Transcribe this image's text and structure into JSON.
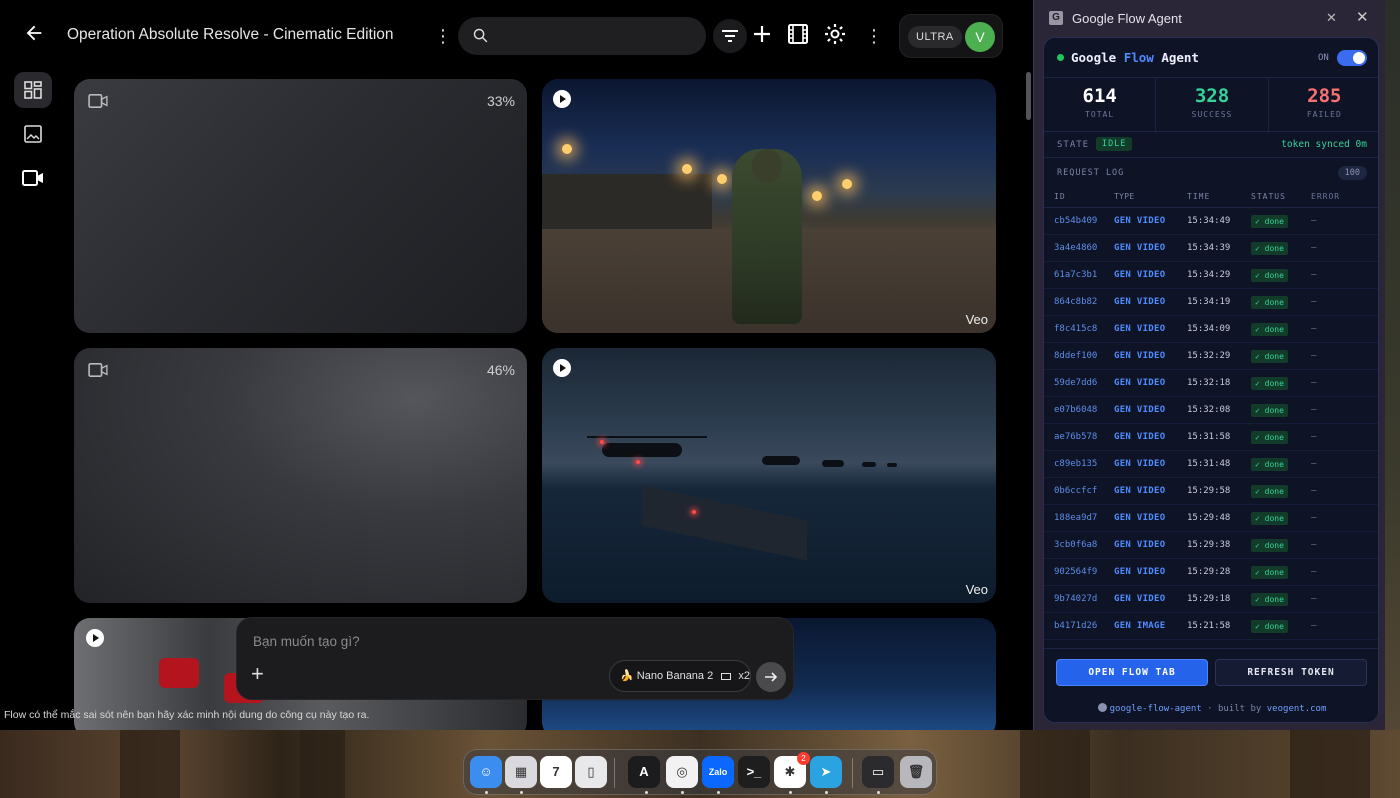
{
  "flow": {
    "project_title": "Operation Absolute Resolve - Cinematic Edition",
    "search_placeholder": "",
    "plan_badge": "ULTRA",
    "avatar_letter": "V",
    "tiles": [
      {
        "kind": "pending",
        "progress": "33%"
      },
      {
        "kind": "video",
        "label": "Veo"
      },
      {
        "kind": "pending",
        "progress": "46%"
      },
      {
        "kind": "video",
        "label": "Veo"
      }
    ],
    "prompt_placeholder": "Bạn muốn tạo gì?",
    "model_chip": {
      "name": "Nano Banana 2",
      "count": "x2",
      "emoji": "🍌"
    },
    "disclaimer": "Flow có thể mắc sai sót nên bạn hãy xác minh nội dung do công cụ này tạo ra."
  },
  "agent": {
    "window_title": "Google Flow Agent",
    "title_prefix": "Google ",
    "title_accent": "Flow",
    "title_suffix": " Agent",
    "toggle_label": "ON",
    "stats": [
      {
        "value": "614",
        "label": "TOTAL",
        "color": "#ffffff"
      },
      {
        "value": "328",
        "label": "SUCCESS",
        "color": "#34d399"
      },
      {
        "value": "285",
        "label": "FAILED",
        "color": "#f87171"
      }
    ],
    "state_label": "STATE",
    "state_value": "IDLE",
    "token_status": "token synced 0m",
    "log_label": "REQUEST LOG",
    "log_count": "100",
    "columns": [
      "ID",
      "TYPE",
      "TIME",
      "STATUS",
      "ERROR"
    ],
    "rows": [
      {
        "id": "cb54b409",
        "type": "GEN VIDEO",
        "time": "15:34:49",
        "status": "✓ done",
        "error": "—"
      },
      {
        "id": "3a4e4860",
        "type": "GEN VIDEO",
        "time": "15:34:39",
        "status": "✓ done",
        "error": "—"
      },
      {
        "id": "61a7c3b1",
        "type": "GEN VIDEO",
        "time": "15:34:29",
        "status": "✓ done",
        "error": "—"
      },
      {
        "id": "864c8b82",
        "type": "GEN VIDEO",
        "time": "15:34:19",
        "status": "✓ done",
        "error": "—"
      },
      {
        "id": "f8c415c8",
        "type": "GEN VIDEO",
        "time": "15:34:09",
        "status": "✓ done",
        "error": "—"
      },
      {
        "id": "8ddef100",
        "type": "GEN VIDEO",
        "time": "15:32:29",
        "status": "✓ done",
        "error": "—"
      },
      {
        "id": "59de7dd6",
        "type": "GEN VIDEO",
        "time": "15:32:18",
        "status": "✓ done",
        "error": "—"
      },
      {
        "id": "e07b6048",
        "type": "GEN VIDEO",
        "time": "15:32:08",
        "status": "✓ done",
        "error": "—"
      },
      {
        "id": "ae76b578",
        "type": "GEN VIDEO",
        "time": "15:31:58",
        "status": "✓ done",
        "error": "—"
      },
      {
        "id": "c89eb135",
        "type": "GEN VIDEO",
        "time": "15:31:48",
        "status": "✓ done",
        "error": "—"
      },
      {
        "id": "0b6ccfcf",
        "type": "GEN VIDEO",
        "time": "15:29:58",
        "status": "✓ done",
        "error": "—"
      },
      {
        "id": "188ea9d7",
        "type": "GEN VIDEO",
        "time": "15:29:48",
        "status": "✓ done",
        "error": "—"
      },
      {
        "id": "3cb0f6a8",
        "type": "GEN VIDEO",
        "time": "15:29:38",
        "status": "✓ done",
        "error": "—"
      },
      {
        "id": "902564f9",
        "type": "GEN VIDEO",
        "time": "15:29:28",
        "status": "✓ done",
        "error": "—"
      },
      {
        "id": "9b74027d",
        "type": "GEN VIDEO",
        "time": "15:29:18",
        "status": "✓ done",
        "error": "—"
      },
      {
        "id": "b4171d26",
        "type": "GEN IMAGE",
        "time": "15:21:58",
        "status": "✓ done",
        "error": "—"
      }
    ],
    "open_button": "OPEN FLOW TAB",
    "refresh_button": "REFRESH TOKEN",
    "footer_repo": "google-flow-agent",
    "footer_sep": " · built by ",
    "footer_site": "veogent.com"
  },
  "dock": {
    "apps": [
      {
        "name": "finder",
        "color": "#3b8df0",
        "glyph": "☺"
      },
      {
        "name": "launchpad",
        "color": "#d9d9de",
        "glyph": "▦"
      },
      {
        "name": "calendar",
        "color": "#ffffff",
        "glyph": "7"
      },
      {
        "name": "iphone-mirroring",
        "color": "#e8e8ea",
        "glyph": "▯"
      },
      {
        "name": "arc",
        "color": "#1c1c1e",
        "glyph": "A"
      },
      {
        "name": "chrome",
        "color": "#f2f2f2",
        "glyph": "◎"
      },
      {
        "name": "zalo",
        "color": "#0a68ff",
        "glyph": "Zalo"
      },
      {
        "name": "terminal",
        "color": "#1e1e1e",
        "glyph": ">_"
      },
      {
        "name": "slack",
        "color": "#ffffff",
        "glyph": "✱",
        "badge": "2"
      },
      {
        "name": "telegram",
        "color": "#2aa3e0",
        "glyph": "➤"
      },
      {
        "name": "screen",
        "color": "#2b2b2e",
        "glyph": "▭"
      },
      {
        "name": "trash",
        "color": "#b8b8bc",
        "glyph": "🗑"
      }
    ]
  }
}
